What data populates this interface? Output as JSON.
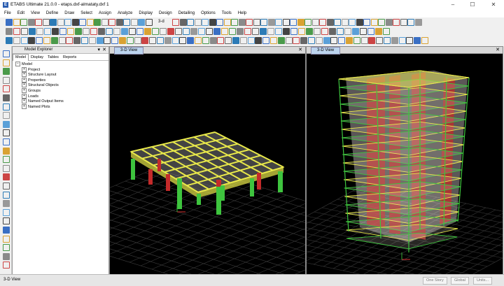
{
  "window": {
    "title": "ETABS Ultimate 21.0.0 - etaps.dxf-almataty.dxf 1",
    "icon_name": "etabs-app-icon",
    "minimize": "–",
    "maximize": "☐",
    "close": "✕"
  },
  "menubar": {
    "items": [
      "File",
      "Edit",
      "View",
      "Define",
      "Draw",
      "Select",
      "Assign",
      "Analyze",
      "Display",
      "Design",
      "Detailing",
      "Options",
      "Tools",
      "Help"
    ]
  },
  "toolbar": {
    "row1_icons": [
      "new-model-icon",
      "open-icon",
      "save-icon",
      "undo-icon",
      "redo-icon",
      "lock-icon",
      "unlock-icon",
      "run-analysis-icon",
      "zoom-in-icon",
      "zoom-window-icon",
      "zoom-out-icon",
      "zoom-fit-icon",
      "pan-icon",
      "refresh-icon",
      "3d-view-icon",
      "plan-view-icon",
      "elevation-view-icon",
      "rotate-icon",
      "perspective-icon",
      "move-up-icon",
      "move-down-icon",
      "object-shrink-icon",
      "set-display-icon",
      "extrude-icon",
      "display-options-icon",
      "deformed-shape-icon",
      "forces-icon",
      "graph-icon",
      "table-icon",
      "design-icon",
      "text-tool-icon",
      "frame-section-icon",
      "member-icon",
      "shell-icon",
      "link-icon"
    ],
    "view_3d_label": "3-d"
  },
  "left_tools": [
    "pointer-icon",
    "pan-tool-icon",
    "draw-line-icon",
    "draw-beam-icon",
    "draw-column-icon",
    "draw-brace-icon",
    "draw-wall-icon",
    "draw-slab-icon",
    "draw-opening-icon",
    "draw-point-icon",
    "quick-draw-icon",
    "draw-dimension-icon",
    "draw-grid-icon",
    "select-all-icon",
    "intersect-icon",
    "snap-icon",
    "measure-icon",
    "layer-icon",
    "section-cut-icon",
    "reshape-icon",
    "text-icon",
    "ruler-icon",
    "annotation-icon",
    "strip-icon",
    "tendon-icon"
  ],
  "explorer": {
    "title": "Model Explorer",
    "tabs": [
      "Model",
      "Display",
      "Tables",
      "Reports"
    ],
    "active_tab": "Model",
    "root": "Model",
    "items": [
      "Project",
      "Structure Layout",
      "Properties",
      "Structural Objects",
      "Groups",
      "Loads",
      "Named Output Items",
      "Named Plots"
    ]
  },
  "views": {
    "left_tab": "3-D View",
    "right_tab": "3-D View",
    "close_glyph": "✕"
  },
  "status": {
    "left": "3-D View",
    "story": "One Story",
    "global": "Global",
    "units": "Units..."
  },
  "colors": {
    "beam_yellow": "#e8e84a",
    "column_green": "#3ec43e",
    "wall_red": "#c42a2a",
    "slab_gray": "#7a7a7a",
    "grid_gray": "#3a3a3a",
    "background": "#000000",
    "tab_blue": "#bcd4ee"
  }
}
